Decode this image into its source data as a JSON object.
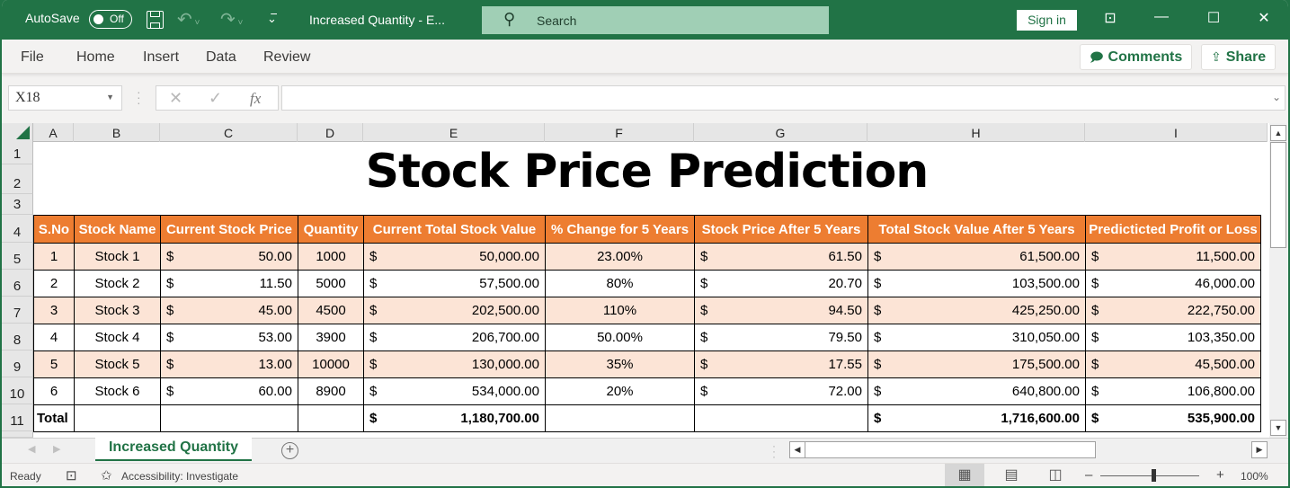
{
  "titlebar": {
    "autosave_label": "AutoSave",
    "autosave_state": "Off",
    "doc_title": "Increased Quantity  -  E...",
    "search_placeholder": "Search",
    "signin_label": "Sign in"
  },
  "ribbon": {
    "tabs": [
      "File",
      "Home",
      "Insert",
      "Data",
      "Review"
    ],
    "comments_label": "Comments",
    "share_label": "Share"
  },
  "formula_bar": {
    "name_box": "X18",
    "formula": ""
  },
  "grid": {
    "columns": [
      "A",
      "B",
      "C",
      "D",
      "E",
      "F",
      "G",
      "H",
      "I"
    ],
    "rows": [
      "1",
      "2",
      "3",
      "4",
      "5",
      "6",
      "7",
      "8",
      "9",
      "10",
      "11"
    ],
    "title": "Stock Price Prediction",
    "headers": [
      "S.No",
      "Stock Name",
      "Current Stock Price",
      "Quantity",
      "Current Total Stock Value",
      "% Change for 5 Years",
      "Stock Price After 5 Years",
      "Total Stock Value After 5 Years",
      "Predicticted Profit or Loss"
    ],
    "currency_symbol": "$",
    "data_rows": [
      {
        "sno": "1",
        "name": "Stock 1",
        "price": "50.00",
        "qty": "1000",
        "value": "50,000.00",
        "change": "23.00%",
        "price5": "61.50",
        "value5": "61,500.00",
        "profit": "11,500.00"
      },
      {
        "sno": "2",
        "name": "Stock 2",
        "price": "11.50",
        "qty": "5000",
        "value": "57,500.00",
        "change": "80%",
        "price5": "20.70",
        "value5": "103,500.00",
        "profit": "46,000.00"
      },
      {
        "sno": "3",
        "name": "Stock 3",
        "price": "45.00",
        "qty": "4500",
        "value": "202,500.00",
        "change": "110%",
        "price5": "94.50",
        "value5": "425,250.00",
        "profit": "222,750.00"
      },
      {
        "sno": "4",
        "name": "Stock 4",
        "price": "53.00",
        "qty": "3900",
        "value": "206,700.00",
        "change": "50.00%",
        "price5": "79.50",
        "value5": "310,050.00",
        "profit": "103,350.00"
      },
      {
        "sno": "5",
        "name": "Stock 5",
        "price": "13.00",
        "qty": "10000",
        "value": "130,000.00",
        "change": "35%",
        "price5": "17.55",
        "value5": "175,500.00",
        "profit": "45,500.00"
      },
      {
        "sno": "6",
        "name": "Stock 6",
        "price": "60.00",
        "qty": "8900",
        "value": "534,000.00",
        "change": "20%",
        "price5": "72.00",
        "value5": "640,800.00",
        "profit": "106,800.00"
      }
    ],
    "total_row": {
      "label": "Total",
      "value": "1,180,700.00",
      "value5": "1,716,600.00",
      "profit": "535,900.00"
    },
    "colors": {
      "header_bg": "#ed7d31",
      "alt_row_bg": "#fce4d6"
    }
  },
  "sheet_tabs": {
    "active": "Increased Quantity"
  },
  "statusbar": {
    "ready": "Ready",
    "accessibility": "Accessibility: Investigate",
    "zoom_level": "100%"
  }
}
